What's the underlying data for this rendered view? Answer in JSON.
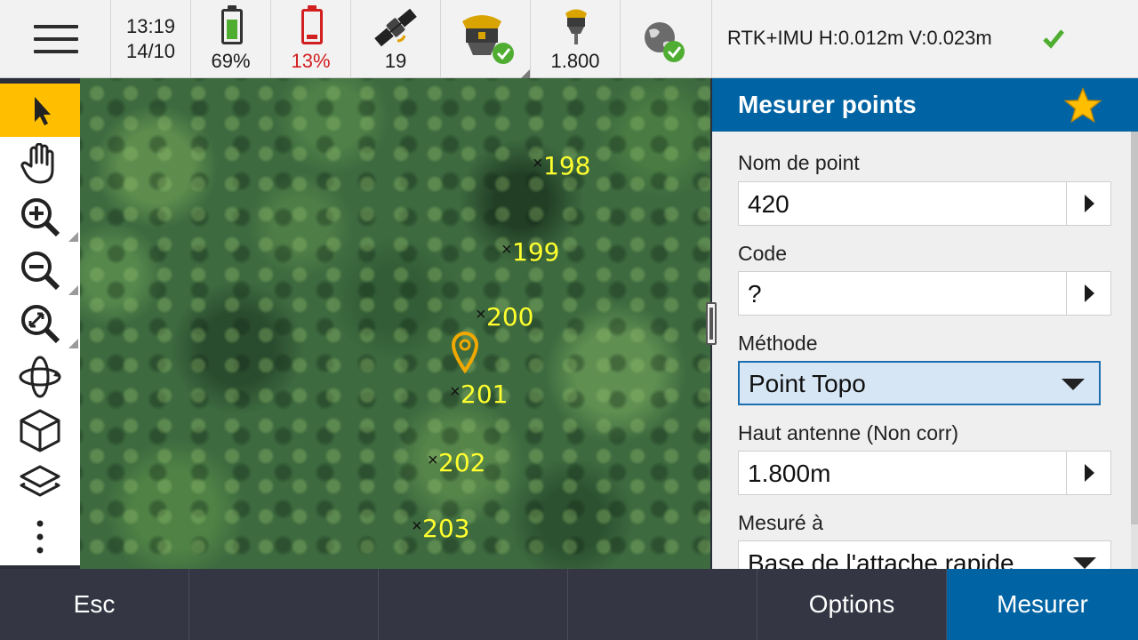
{
  "status": {
    "time": "13:19",
    "date": "14/10",
    "controller_battery": "69%",
    "receiver_battery": "13%",
    "satellites": "19",
    "antenna_height": "1.800",
    "precision": "RTK+IMU H:0.012m V:0.023m",
    "colors": {
      "battery_ok": "#4fae32",
      "battery_low": "#d21f1f",
      "check": "#4fae32"
    }
  },
  "toolbar": {
    "tools": [
      "select-arrow-icon",
      "pan-hand-icon",
      "zoom-in-icon",
      "zoom-out-icon",
      "zoom-extents-icon",
      "orbit-icon",
      "cube-icon",
      "layers-icon",
      "more-vertical-icon"
    ]
  },
  "map": {
    "points": [
      {
        "label": "198"
      },
      {
        "label": "199"
      },
      {
        "label": "200"
      },
      {
        "label": "201"
      },
      {
        "label": "202"
      },
      {
        "label": "203"
      }
    ],
    "label_color": "#ffff2e",
    "pin_color": "#f0a800"
  },
  "panel": {
    "title": "Mesurer points",
    "fields": {
      "point_name": {
        "label": "Nom de point",
        "value": "420"
      },
      "code": {
        "label": "Code",
        "value": "?"
      },
      "method": {
        "label": "Méthode",
        "value": "Point Topo"
      },
      "antenna_height": {
        "label": "Haut antenne (Non corr)",
        "value": "1.800m"
      },
      "measured_to": {
        "label": "Mesuré à",
        "value": "Base de l'attache rapide"
      }
    },
    "header_color": "#0063a3",
    "star_color": "#ffbf00"
  },
  "softkeys": {
    "esc": "Esc",
    "options": "Options",
    "measure": "Mesurer"
  }
}
